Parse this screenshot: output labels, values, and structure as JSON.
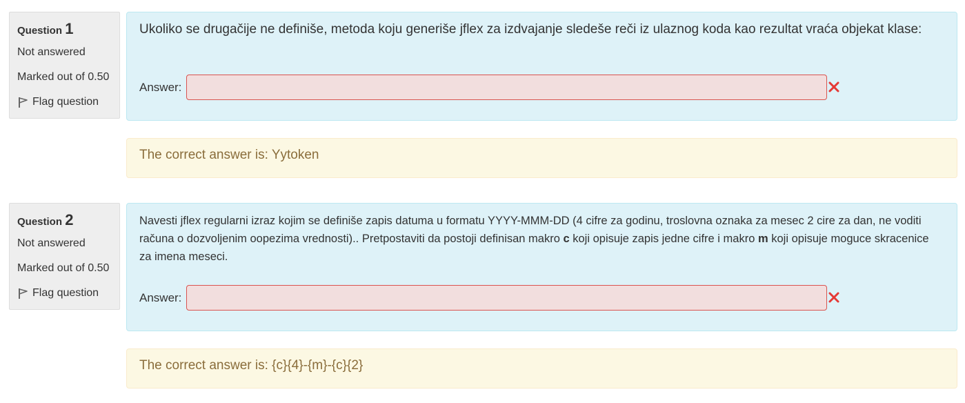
{
  "questions": [
    {
      "label": "Question",
      "number": "1",
      "state": "Not answered",
      "grade": "Marked out of 0.50",
      "flag_label": "Flag question",
      "text": "Ukoliko se drugačije ne definiše, metoda koju generiše jflex za izdvajanje sledeše reči iz ulaznog koda kao rezultat vraća objekat klase:",
      "answer_label": "Answer:",
      "answer_value": "",
      "feedback": "The correct answer is: Yytoken"
    },
    {
      "label": "Question",
      "number": "2",
      "state": "Not answered",
      "grade": "Marked out of 0.50",
      "flag_label": "Flag question",
      "text_parts": [
        "Navesti jflex regularni izraz kojim se definiše zapis datuma u formatu YYYY-MMM-DD (4 cifre za godinu, troslovna oznaka za mesec 2 cire za dan, ne voditi računa o dozvoljenim oopezima vrednosti).. Pretpostaviti da postoji definisan makro ",
        "c",
        " koji opisuje zapis jedne cifre i makro ",
        "m",
        " koji opisuje moguce skracenice za imena meseci."
      ],
      "answer_label": "Answer:",
      "answer_value": "",
      "feedback": "The correct answer is: {c}{4}-{m}-{c}{2}"
    }
  ],
  "colors": {
    "info_bg": "#eeeeee",
    "formulation_bg": "#def2f8",
    "input_error_bg": "#f2dede",
    "input_error_border": "#d9534f",
    "incorrect_icon": "#e53935",
    "outcome_bg": "#fcf8e3",
    "outcome_text": "#8a6d3b"
  },
  "icons": {
    "flag": "flag-icon",
    "incorrect": "incorrect-cross-icon"
  }
}
